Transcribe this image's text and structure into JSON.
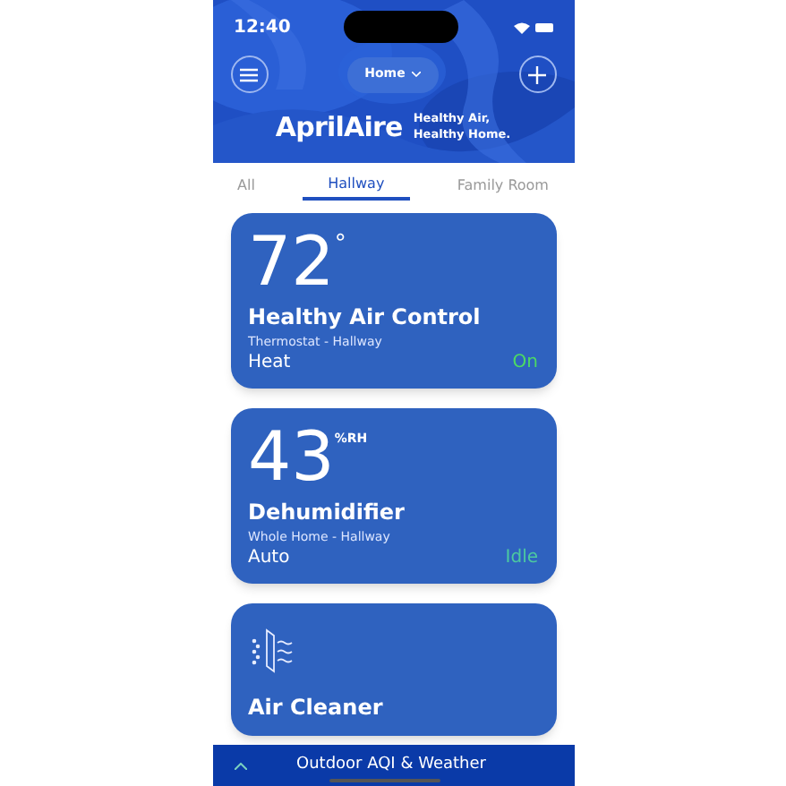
{
  "status_bar": {
    "time": "12:40"
  },
  "header": {
    "location": "Home",
    "brand": "AprilAire",
    "tagline_1": "Healthy Air,",
    "tagline_2": "Healthy Home."
  },
  "tabs": [
    {
      "label": "All",
      "selected": false
    },
    {
      "label": "Hallway",
      "selected": true
    },
    {
      "label": "Family Room",
      "selected": false
    }
  ],
  "devices": [
    {
      "kind": "value",
      "value": "72",
      "unit": "°",
      "name": "Healthy Air Control",
      "location": "Thermostat - Hallway",
      "mode": "Heat",
      "status": "On",
      "color": "#4cd964"
    },
    {
      "kind": "value",
      "value": "43",
      "unit": "%RH",
      "name": "Dehumidifier",
      "location": "Whole Home - Hallway",
      "mode": "Auto",
      "status": "Idle",
      "color": "#4cc9a0"
    },
    {
      "kind": "icon",
      "name": "Air Cleaner"
    }
  ],
  "bottom_bar": {
    "label": "Outdoor AQI & Weather"
  }
}
